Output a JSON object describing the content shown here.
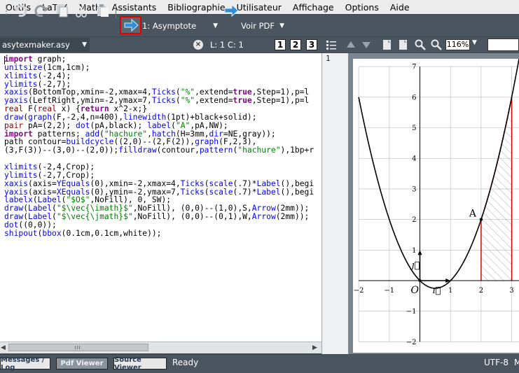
{
  "menu": [
    "Outils",
    "LaTeX",
    "Math",
    "Assistants",
    "Bibliographie",
    "Utilisateur",
    "Affichage",
    "Options",
    "Aide"
  ],
  "toolbar": {
    "run_combo": "1: Asymptote",
    "view_combo": "Voir PDF"
  },
  "editor_bar": {
    "file": "asytexmaker.asy",
    "position": "L: 1 C: 1",
    "bookmarks": [
      "1",
      "2",
      "3"
    ]
  },
  "viewer_bar": {
    "zoom": "116%"
  },
  "line_number": "1",
  "code_lines": [
    [
      [
        "kw",
        "import"
      ],
      [
        "t",
        " graph;"
      ]
    ],
    [
      [
        "fn",
        "unitsize"
      ],
      [
        "t",
        "(1cm,1cm);"
      ]
    ],
    [
      [
        "fn",
        "xlimits"
      ],
      [
        "t",
        "(-2,4);"
      ]
    ],
    [
      [
        "fn",
        "ylimits"
      ],
      [
        "t",
        "(-2,7);"
      ]
    ],
    [
      [
        "fn",
        "xaxis"
      ],
      [
        "t",
        "(BottomTop,xmin=-2,xmax=4,"
      ],
      [
        "fn",
        "Ticks"
      ],
      [
        "t",
        "("
      ],
      [
        "str",
        "\"%\""
      ],
      [
        "t",
        ",extend="
      ],
      [
        "kw",
        "true"
      ],
      [
        "t",
        ",Step=1),p=l"
      ]
    ],
    [
      [
        "fn",
        "yaxis"
      ],
      [
        "t",
        "(LeftRight,ymin=-2,ymax=7,"
      ],
      [
        "fn",
        "Ticks"
      ],
      [
        "t",
        "("
      ],
      [
        "str",
        "\"%\""
      ],
      [
        "t",
        ",extend="
      ],
      [
        "kw",
        "true"
      ],
      [
        "t",
        ",Step=1),p=l"
      ]
    ],
    [
      [
        "ts",
        "real"
      ],
      [
        "t",
        " F("
      ],
      [
        "ts",
        "real"
      ],
      [
        "t",
        " x) {"
      ],
      [
        "kw",
        "return"
      ],
      [
        "t",
        " x^2-x;}"
      ]
    ],
    [
      [
        "fn",
        "draw"
      ],
      [
        "t",
        "("
      ],
      [
        "fn",
        "graph"
      ],
      [
        "t",
        "(F,-2,4,n=400),"
      ],
      [
        "fn",
        "linewidth"
      ],
      [
        "t",
        "(1pt)+black+solid);"
      ]
    ],
    [
      [
        "ts",
        "pair"
      ],
      [
        "t",
        " pA=(2,2); "
      ],
      [
        "fn",
        "dot"
      ],
      [
        "t",
        "(pA,black); "
      ],
      [
        "fn",
        "label"
      ],
      [
        "t",
        "("
      ],
      [
        "str",
        "\"A\""
      ],
      [
        "t",
        ",pA,NW);"
      ]
    ],
    [
      [
        "kw",
        "import"
      ],
      [
        "t",
        " patterns; "
      ],
      [
        "fn",
        "add"
      ],
      [
        "t",
        "("
      ],
      [
        "str",
        "\"hachure\""
      ],
      [
        "t",
        ","
      ],
      [
        "fn",
        "hatch"
      ],
      [
        "t",
        "(H=3mm,"
      ],
      [
        "fn",
        "dir"
      ],
      [
        "t",
        "=NE,gray));"
      ]
    ],
    [
      [
        "t",
        "path contour="
      ],
      [
        "fn",
        "buildcycle"
      ],
      [
        "t",
        "((2,0)--(2,F(2)),"
      ],
      [
        "fn",
        "graph"
      ],
      [
        "t",
        "(F,2,3),"
      ]
    ],
    [
      [
        "t",
        "(3,F(3))--(3,0)--(2,0));"
      ],
      [
        "fn",
        "filldraw"
      ],
      [
        "t",
        "(contour,"
      ],
      [
        "fn",
        "pattern"
      ],
      [
        "t",
        "("
      ],
      [
        "str",
        "\"hachure\""
      ],
      [
        "t",
        "),1bp+r"
      ]
    ],
    [
      [
        "t",
        " "
      ]
    ],
    [
      [
        "fn",
        "xlimits"
      ],
      [
        "t",
        "(-2,4,Crop);"
      ]
    ],
    [
      [
        "fn",
        "ylimits"
      ],
      [
        "t",
        "(-2,7,Crop);"
      ]
    ],
    [
      [
        "fn",
        "xaxis"
      ],
      [
        "t",
        "(axis="
      ],
      [
        "fn",
        "YEquals"
      ],
      [
        "t",
        "(0),xmin=-2,xmax=4,"
      ],
      [
        "fn",
        "Ticks"
      ],
      [
        "t",
        "("
      ],
      [
        "fn",
        "scale"
      ],
      [
        "t",
        "(.7)*"
      ],
      [
        "fn",
        "Label"
      ],
      [
        "t",
        "(),begi"
      ]
    ],
    [
      [
        "fn",
        "yaxis"
      ],
      [
        "t",
        "(axis="
      ],
      [
        "fn",
        "XEquals"
      ],
      [
        "t",
        "(0),ymin=-2,ymax=7,"
      ],
      [
        "fn",
        "Ticks"
      ],
      [
        "t",
        "("
      ],
      [
        "fn",
        "scale"
      ],
      [
        "t",
        "(.7)*"
      ],
      [
        "fn",
        "Label"
      ],
      [
        "t",
        "(),begi"
      ]
    ],
    [
      [
        "fn",
        "labelx"
      ],
      [
        "t",
        "("
      ],
      [
        "fn",
        "Label"
      ],
      [
        "t",
        "("
      ],
      [
        "str",
        "\"$O$\""
      ],
      [
        "t",
        ",NoFill), 0, SW);"
      ]
    ],
    [
      [
        "fn",
        "draw"
      ],
      [
        "t",
        "("
      ],
      [
        "fn",
        "Label"
      ],
      [
        "t",
        "("
      ],
      [
        "str",
        "\"$\\vec{\\imath}$\""
      ],
      [
        "t",
        ",NoFill), (0,0)--(1,0),S,"
      ],
      [
        "fn",
        "Arrow"
      ],
      [
        "t",
        "(2mm));"
      ]
    ],
    [
      [
        "fn",
        "draw"
      ],
      [
        "t",
        "("
      ],
      [
        "fn",
        "Label"
      ],
      [
        "t",
        "("
      ],
      [
        "str",
        "\"$\\vec{\\jmath}$\""
      ],
      [
        "t",
        ",NoFill), (0,0)--(0,1),W,"
      ],
      [
        "fn",
        "Arrow"
      ],
      [
        "t",
        "(2mm));"
      ]
    ],
    [
      [
        "fn",
        "dot"
      ],
      [
        "t",
        "((0,0));"
      ]
    ],
    [
      [
        "fn",
        "shipout"
      ],
      [
        "t",
        "("
      ],
      [
        "fn",
        "bbox"
      ],
      [
        "t",
        "(0.1cm,0.1cm,white));"
      ]
    ]
  ],
  "plot": {
    "x_ticks": [
      "−2",
      "−1",
      "1",
      "2",
      "3"
    ],
    "y_ticks": [
      "7",
      "6",
      "5",
      "4",
      "3",
      "2",
      "1",
      "−1",
      "−2"
    ],
    "origin_label": "O",
    "point_label": "A",
    "i_label": "ı⃗",
    "j_label": "ȷ⃗"
  },
  "chart_data": {
    "type": "line",
    "function": "x^2 - x",
    "x": [
      -2,
      -1,
      0,
      1,
      2,
      3
    ],
    "y": [
      6,
      2,
      0,
      0,
      2,
      6
    ],
    "xlim": [
      -2,
      4
    ],
    "ylim": [
      -2,
      7
    ],
    "grid": true,
    "point_A": [
      2,
      2
    ],
    "hatched_region_x": [
      2,
      3
    ]
  },
  "status": {
    "tabs": [
      "Messages / Log",
      "Pdf Viewer",
      "Source Viewer"
    ],
    "ready": "Ready",
    "encoding": "UTF-8",
    "mode": "M"
  }
}
